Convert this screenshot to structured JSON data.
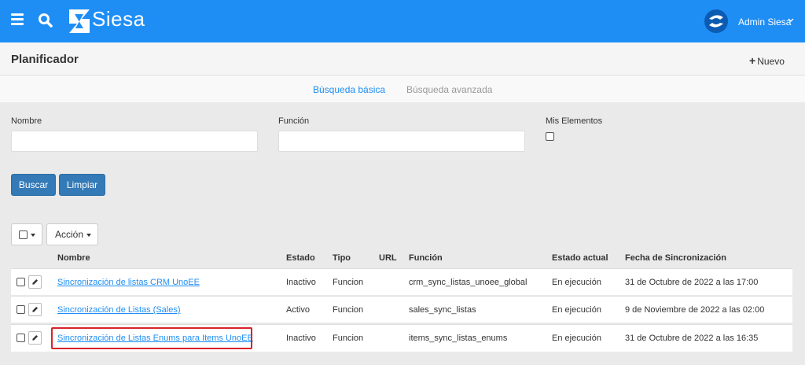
{
  "header": {
    "brand": "Siesa",
    "user_name": "Admin Siesa",
    "colors": {
      "primary": "#1e8ef5",
      "highlight": "#d9222a"
    }
  },
  "page": {
    "title": "Planificador",
    "new_button": "Nuevo"
  },
  "tabs": {
    "basic": "Búsqueda básica",
    "advanced": "Búsqueda avanzada"
  },
  "filters": {
    "name_label": "Nombre",
    "name_value": "",
    "function_label": "Función",
    "function_value": "",
    "mine_label": "Mis Elementos"
  },
  "actions": {
    "search": "Buscar",
    "clear": "Limpiar",
    "action_dropdown": "Acción"
  },
  "table": {
    "headers": {
      "name": "Nombre",
      "state": "Estado",
      "type": "Tipo",
      "url": "URL",
      "function": "Función",
      "current_state": "Estado actual",
      "sync_date": "Fecha de Sincronización"
    },
    "rows": [
      {
        "name": "Sincronización de listas CRM UnoEE",
        "state": "Inactivo",
        "type": "Funcion",
        "url": "",
        "function": "crm_sync_listas_unoee_global",
        "current_state": "En ejecución",
        "sync_date": "31 de Octubre de 2022 a las 17:00"
      },
      {
        "name": "Sincronización de Listas (Sales)",
        "state": "Activo",
        "type": "Funcion",
        "url": "",
        "function": "sales_sync_listas",
        "current_state": "En ejecución",
        "sync_date": "9 de Noviembre de 2022 a las 02:00"
      },
      {
        "name": "Sincronización de Listas Enums para Items UnoEE",
        "state": "Inactivo",
        "type": "Funcion",
        "url": "",
        "function": "items_sync_listas_enums",
        "current_state": "En ejecución",
        "sync_date": "31 de Octubre de 2022 a las 16:35"
      }
    ]
  }
}
